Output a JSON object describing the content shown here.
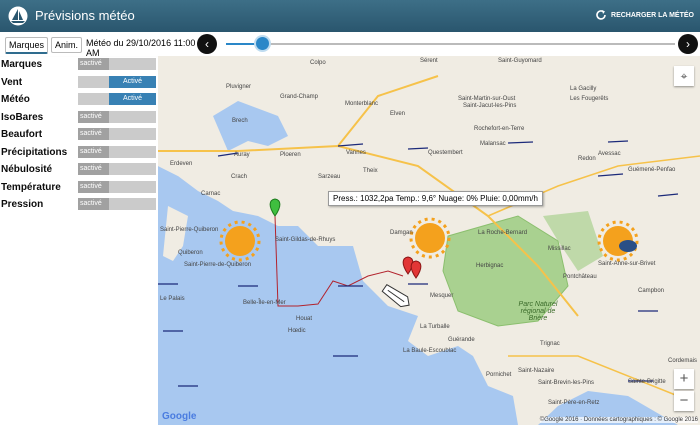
{
  "app": {
    "title": "Prévisions météo",
    "reload_label": "RECHARGER LA MÉTÉO"
  },
  "toolbar": {
    "tab_markers": "Marques",
    "tab_anim": "Anim.",
    "date_text": "Météo du 29/10/2016 11:00 AM",
    "prev_symbol": "‹",
    "next_symbol": "›",
    "timeline_progress": 0.08
  },
  "layers": [
    {
      "label": "Marques",
      "state": "off",
      "off_text": "sactivé",
      "on_text": ""
    },
    {
      "label": "Vent",
      "state": "on",
      "off_text": "",
      "on_text": "Activé"
    },
    {
      "label": "Météo",
      "state": "on",
      "off_text": "",
      "on_text": "Activé"
    },
    {
      "label": "IsoBares",
      "state": "off",
      "off_text": "sactivé",
      "on_text": ""
    },
    {
      "label": "Beaufort",
      "state": "off",
      "off_text": "sactivé",
      "on_text": ""
    },
    {
      "label": "Précipitations",
      "state": "off",
      "off_text": "sactivé",
      "on_text": ""
    },
    {
      "label": "Nébulosité",
      "state": "off",
      "off_text": "sactivé",
      "on_text": ""
    },
    {
      "label": "Température",
      "state": "off",
      "off_text": "sactivé",
      "on_text": ""
    },
    {
      "label": "Pression",
      "state": "off",
      "off_text": "sactivé",
      "on_text": ""
    }
  ],
  "map": {
    "tooltip": "Press.: 1032,2pa Temp.: 9,6° Nuage: 0% Pluie: 0,00mm/h",
    "park_label": "Parc Naturel régional de Brière",
    "places": [
      "Colpo",
      "Sérent",
      "Saint-Guyomard",
      "La Gacilly",
      "Pluvigner",
      "Grand-Champ",
      "Monterblanc",
      "Elven",
      "Saint-Martin-sur-Oust",
      "Les Fougerêts",
      "Brech",
      "Rochefort-en-Terre",
      "Saint-Jacut-les-Pins",
      "Malansac",
      "Questembert",
      "Redon",
      "Erdeven",
      "Auray",
      "Ploeren",
      "Vannes",
      "Theix",
      "Avessac",
      "Carnac",
      "Crach",
      "Sarzeau",
      "Guémené-Penfao",
      "Saint-Pierre-Quiberon",
      "Saint-Gildas-de-Rhuys",
      "Damgan",
      "La Roche-Bernard",
      "Quiberon",
      "Missillac",
      "Saint-Anne-sur-Brivet",
      "Pontchâteau",
      "Herbignac",
      "Campbon",
      "Le Palais",
      "Belle-Île-en-Mer",
      "Houat",
      "Hœdic",
      "Mesquer",
      "La Baule-Escoublac",
      "Guérande",
      "La Turballe",
      "Trignac",
      "Pornichet",
      "Saint-Nazaire",
      "Saint-Brevin-les-Pins",
      "Saint-Père-en-Retz",
      "Sainte-Brigitte",
      "Cordemais",
      "Saint-Pierre-de-Quiberon"
    ],
    "copyright": "©Google 2016 · Données cartographiques : © Google 2016",
    "google": "Google",
    "zoom_in": "+",
    "zoom_out": "−"
  }
}
